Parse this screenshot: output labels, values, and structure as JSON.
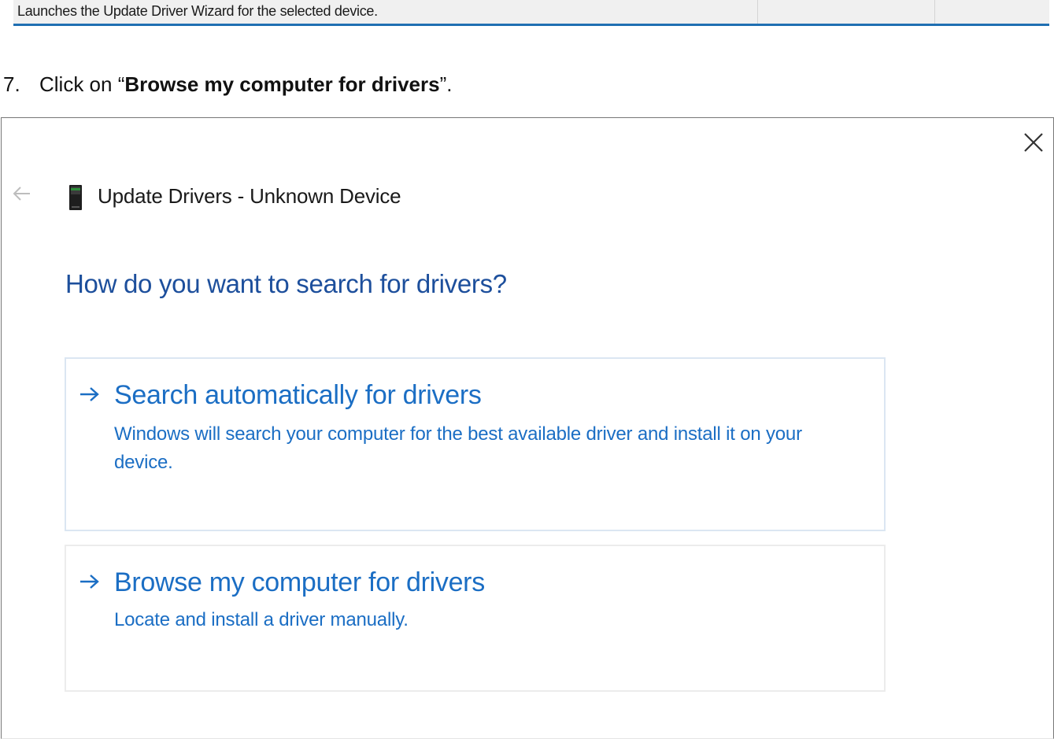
{
  "status_bar": {
    "text": "Launches the Update Driver Wizard for the selected device."
  },
  "instruction": {
    "number": "7.",
    "prefix": "Click on “",
    "emphasis": "Browse my computer for drivers",
    "suffix": "”."
  },
  "dialog": {
    "title": "Update Drivers - Unknown Device",
    "heading": "How do you want to search for drivers?",
    "options": [
      {
        "title": "Search automatically for drivers",
        "description": "Windows will search your computer for the best available driver and install it on your device."
      },
      {
        "title": "Browse my computer for drivers",
        "description": "Locate and install a driver manually."
      }
    ],
    "icons": {
      "close": "close-icon",
      "back": "back-arrow-icon",
      "device": "device-icon",
      "option_arrow": "arrow-right-icon"
    }
  },
  "colors": {
    "link_blue": "#1b6ec4",
    "heading_blue": "#1d4f9c",
    "status_accent": "#1f6fb2"
  }
}
